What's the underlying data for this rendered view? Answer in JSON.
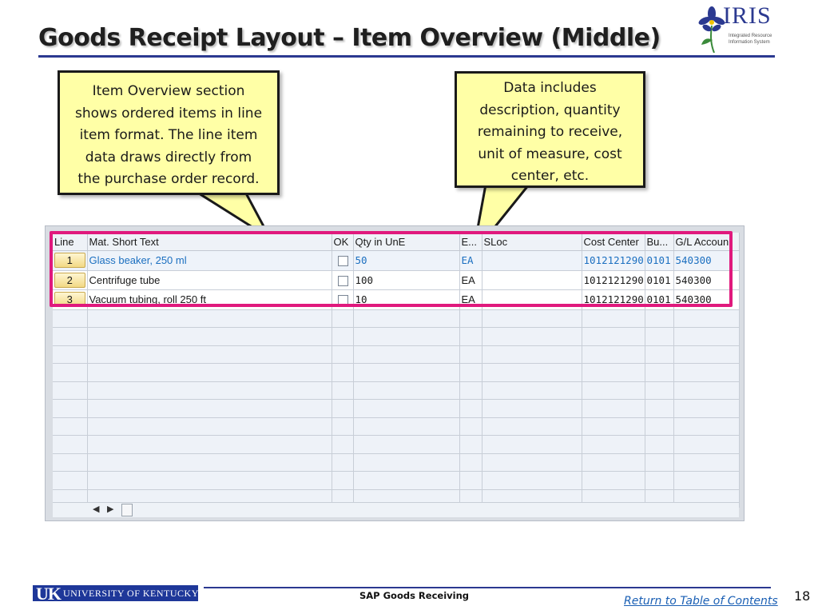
{
  "slide": {
    "title": "Goods Receipt Layout – Item Overview (Middle)",
    "page_number": "18"
  },
  "logo": {
    "word": "IRIS",
    "subtitle_1": "Integrated Resource",
    "subtitle_2": "Information System"
  },
  "callouts": {
    "item_overview": {
      "lines": [
        "Item Overview section",
        "shows ordered items in line",
        "item format. The line item",
        "data draws directly from",
        "the purchase order record."
      ]
    },
    "data_includes": {
      "lines": [
        "Data includes",
        "description, quantity",
        "remaining to receive,",
        "unit of measure, cost",
        "center, etc."
      ]
    }
  },
  "grid": {
    "columns": [
      "Line",
      "Mat. Short Text",
      "OK",
      "Qty in UnE",
      "E...",
      "SLoc",
      "Cost Center",
      "Bu...",
      "G/L Accoun"
    ],
    "rows": [
      {
        "line": "1",
        "text": "Glass beaker, 250 ml",
        "qty": "50",
        "unit": "EA",
        "sloc": "",
        "cost_center": "1012121290",
        "bu": "0101",
        "gl": "540300"
      },
      {
        "line": "2",
        "text": "Centrifuge tube",
        "qty": "100",
        "unit": "EA",
        "sloc": "",
        "cost_center": "1012121290",
        "bu": "0101",
        "gl": "540300"
      },
      {
        "line": "3",
        "text": "Vacuum tubing, roll 250 ft",
        "qty": "10",
        "unit": "EA",
        "sloc": "",
        "cost_center": "1012121290",
        "bu": "0101",
        "gl": "540300"
      }
    ],
    "highlight_color": "#e0197d",
    "selected_text_color": "#1b6fc0",
    "line_button_color": "#f2d985"
  },
  "footer": {
    "uk_mark": "UK",
    "university": "UNIVERSITY OF KENTUCKY",
    "center_text": "SAP Goods Receiving",
    "toc_link": "Return to Table of Contents"
  },
  "colors": {
    "title_rule": "#2b3990",
    "callout_fill": "#ffffa6"
  }
}
